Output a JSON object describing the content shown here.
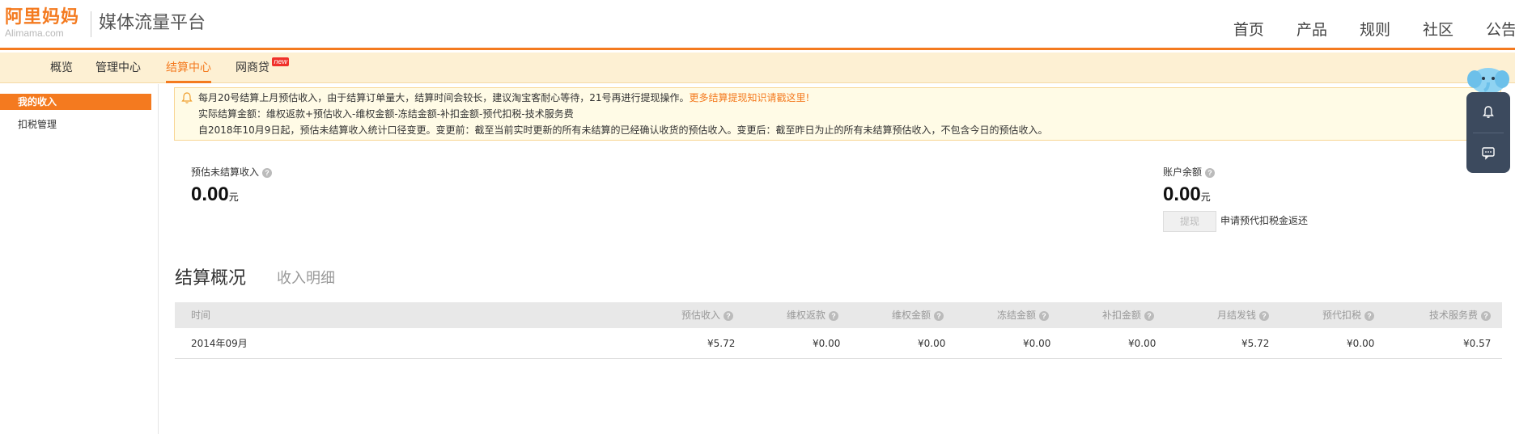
{
  "header": {
    "logo_cn": "阿里妈妈",
    "logo_en": "Alimama.com",
    "platform_title": "媒体流量平台",
    "nav": [
      "首页",
      "产品",
      "规则",
      "社区",
      "公告"
    ]
  },
  "subnav": {
    "items": [
      "概览",
      "管理中心",
      "结算中心",
      "网商贷"
    ],
    "active": "结算中心",
    "badge": "new"
  },
  "sidebar": {
    "items": [
      "我的收入",
      "扣税管理"
    ],
    "active": "我的收入"
  },
  "notice": {
    "line1": "每月20号结算上月预估收入，由于结算订单量大，结算时间会较长，建议淘宝客耐心等待，21号再进行提现操作。",
    "line1_link": "更多结算提现知识请戳这里!",
    "line2": "实际结算金额：维权返款+预估收入-维权金额-冻结金额-补扣金额-预代扣税-技术服务费",
    "line3": "自2018年10月9日起，预估未结算收入统计口径变更。变更前：截至当前实时更新的所有未结算的已经确认收货的预估收入。变更后：截至昨日为止的所有未结算预估收入，不包含今日的预估收入。"
  },
  "summary": {
    "estimated_label": "预估未结算收入",
    "estimated_value": "0.00",
    "balance_label": "账户余额",
    "balance_value": "0.00",
    "unit": "元",
    "withdraw_button": "提现",
    "apply_link": "申请预代扣税金返还"
  },
  "tabs": {
    "settlement": "结算概况",
    "income_detail": "收入明细"
  },
  "table": {
    "headers": [
      "时间",
      "预估收入",
      "维权返款",
      "维权金额",
      "冻结金额",
      "补扣金额",
      "月结发钱",
      "预代扣税",
      "技术服务费"
    ],
    "rows": [
      [
        "2014年09月",
        "¥5.72",
        "¥0.00",
        "¥0.00",
        "¥0.00",
        "¥0.00",
        "¥5.72",
        "¥0.00",
        "¥0.57"
      ]
    ]
  },
  "help_glyph": "?",
  "colors": {
    "brand": "#f47a1f",
    "subnav_bg": "#fdf0d3",
    "notice_bg": "#fffbe6",
    "widget_bg": "#3c4a5e"
  }
}
